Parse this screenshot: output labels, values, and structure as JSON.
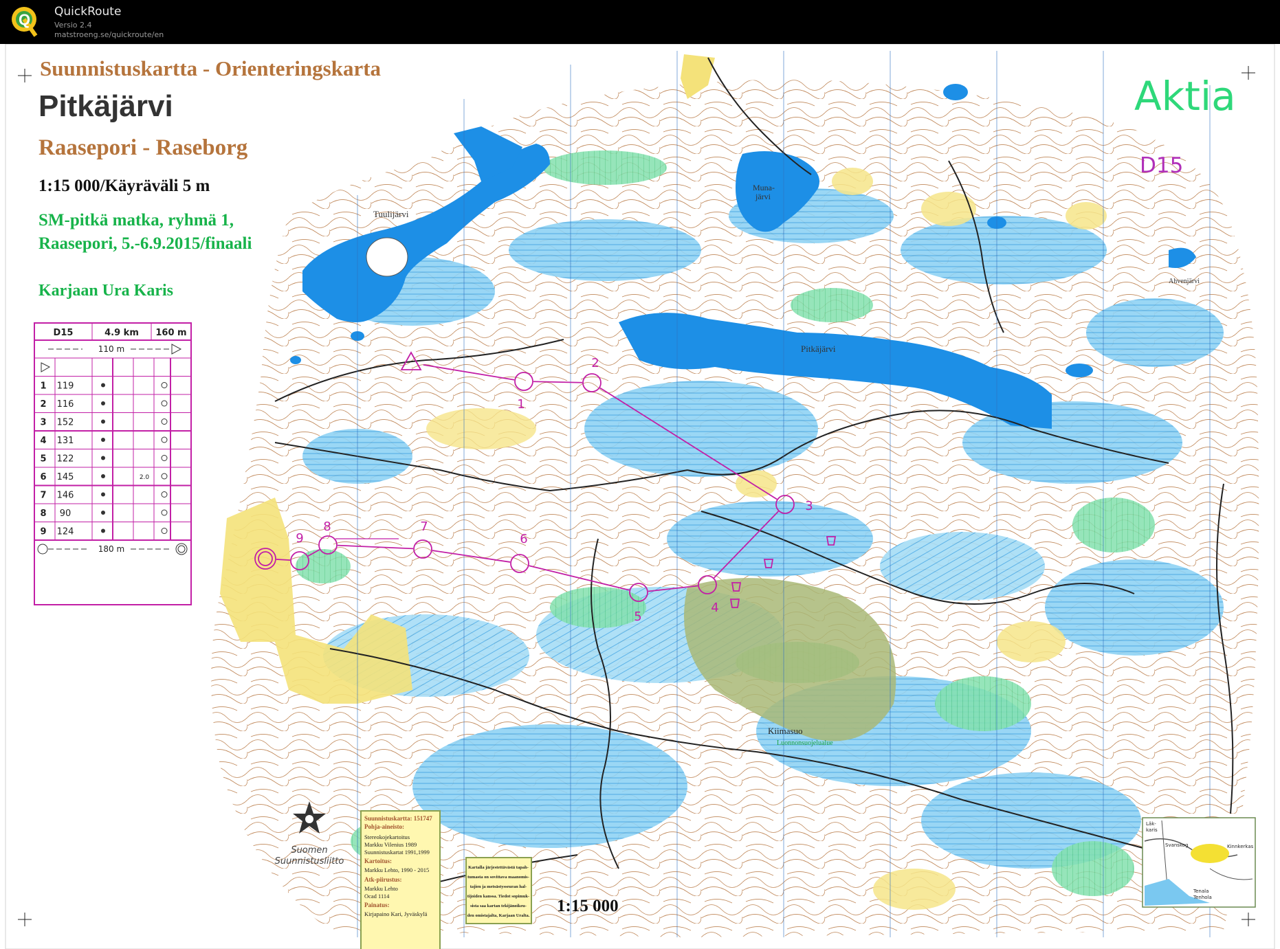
{
  "app": {
    "name": "QuickRoute",
    "version": "Versio 2.4",
    "url": "matstroeng.se/quickroute/en",
    "logo_letter": "Q"
  },
  "map": {
    "header_line1": "Suunnistuskartta - Orienteringskarta",
    "name": "Pitkäjärvi",
    "region": "Raasepori - Raseborg",
    "scale_line": "1:15 000/Käyräväli 5 m",
    "event_line1": "SM-pitkä matka, ryhmä 1,",
    "event_line2": "Raasepori, 5.-6.9.2015/finaali",
    "club": "Karjaan Ura Karis",
    "sponsor": "Aktia",
    "class": "D15",
    "scale_bottom": "1:15 000",
    "federation_line1": "Suomen",
    "federation_line2": "Suunnistusliitto",
    "place_names": {
      "tuulijarvi": "Tuulijärvi",
      "muna1": "Muna-",
      "muna2": "järvi",
      "pitkajarvi": "Pitkäjärvi",
      "ahvenjarvi": "Ahvenjärvi",
      "kiimasuo": "Kiimasuo",
      "reserve": "Luonnonsuojelualue"
    },
    "info_box": {
      "l1": "Suunnistuskartta: 151747",
      "l2": "Pohja-aineisto:",
      "l3": "Stereokojekartoitus",
      "l4": "Markku Vilenius 1989",
      "l5": "Suunnistuskartat 1991,1999",
      "l6": "Kartoitus:",
      "l7": "Markku Lehto, 1990 - 2015",
      "l8": "Atk-piirustus:",
      "l9": "Markku Lehto",
      "l10": "Ocad 1114",
      "l11": "Painatus:",
      "l12": "Kirjapaino Kari, Jyväskylä"
    },
    "copyright_box": [
      "Kartalla järjestettävästä tapah-",
      "tumasta on sovittava maanomis-",
      "tajien ja metsästysseuran hal-",
      "tijoiden kanssa. Tiedot sopimuk-",
      "sista saa kartan tekijänoikeu-",
      "den omistajalta, Karjaan Uralta."
    ],
    "inset_labels": [
      "Läk-",
      "karis",
      "Svanskog",
      "Kinnkerkas",
      "Tenala",
      "Tenhola"
    ]
  },
  "control_card": {
    "class": "D15",
    "length": "4.9 km",
    "climb": "160 m",
    "start_taping": "110 m",
    "finish_taping": "180 m",
    "rows": [
      {
        "n": "1",
        "code": "119",
        "extra": ""
      },
      {
        "n": "2",
        "code": "116",
        "extra": ""
      },
      {
        "n": "3",
        "code": "152",
        "extra": ""
      },
      {
        "n": "4",
        "code": "131",
        "extra": ""
      },
      {
        "n": "5",
        "code": "122",
        "extra": ""
      },
      {
        "n": "6",
        "code": "145",
        "extra": "2.0"
      },
      {
        "n": "7",
        "code": "146",
        "extra": ""
      },
      {
        "n": "8",
        "code": "90",
        "extra": ""
      },
      {
        "n": "9",
        "code": "124",
        "extra": ""
      }
    ]
  },
  "course": {
    "color": "#c21fa6",
    "controls": [
      {
        "label": "1"
      },
      {
        "label": "2"
      },
      {
        "label": "3"
      },
      {
        "label": "4"
      },
      {
        "label": "5"
      },
      {
        "label": "6"
      },
      {
        "label": "7"
      },
      {
        "label": "8"
      },
      {
        "label": "9"
      }
    ]
  },
  "colors": {
    "water": "#1d8fe6",
    "marsh": "#7ac8f0",
    "open": "#f6e58a",
    "green": "#6fd6a0",
    "olive": "#a9b877",
    "contour": "#b06a3a",
    "header_brown": "#b5743c",
    "event_green": "#17b34a",
    "sponsor_green": "#2ed87a",
    "class_purple": "#b02fb8"
  }
}
